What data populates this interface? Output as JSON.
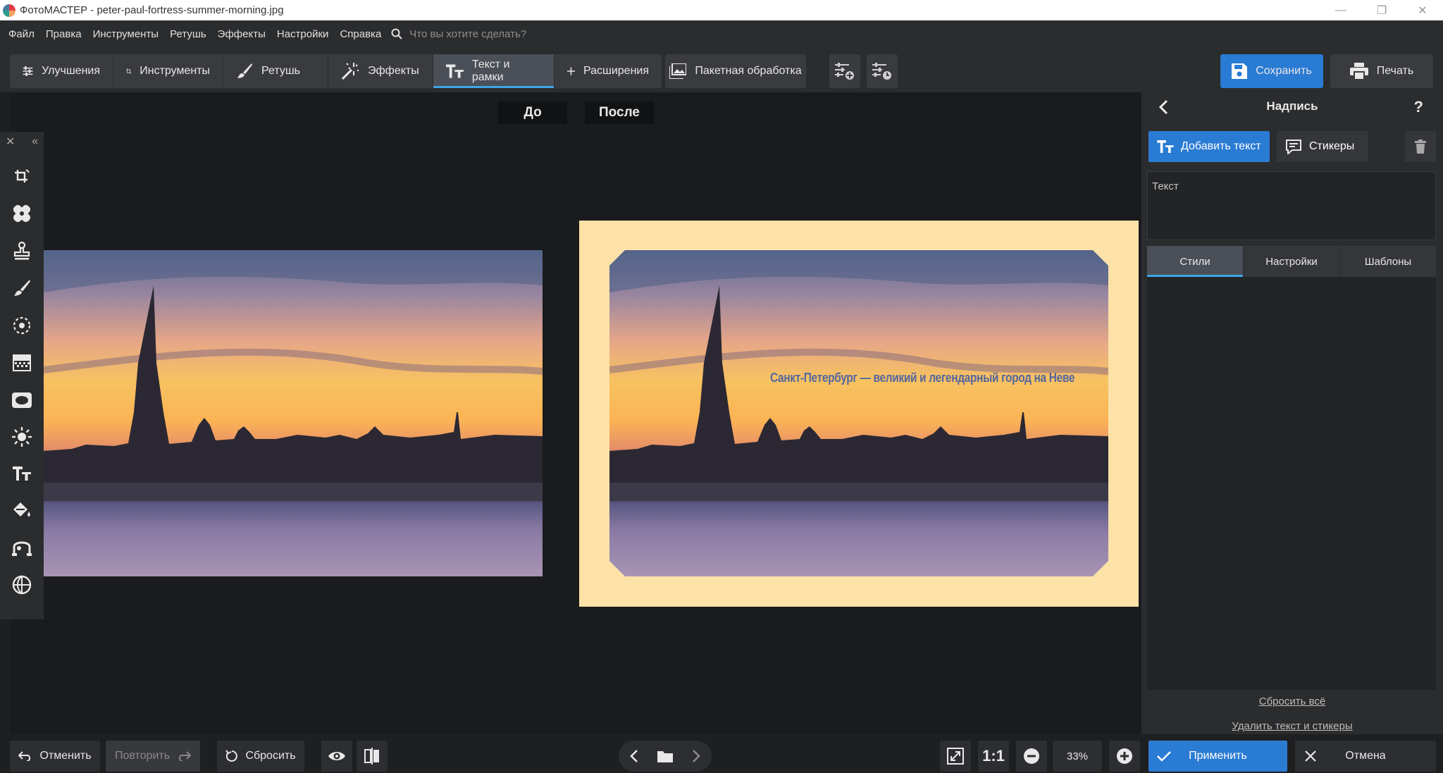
{
  "window": {
    "title": "ФотоМАСТЕР - peter-paul-fortress-summer-morning.jpg"
  },
  "menu": {
    "items": [
      "Файл",
      "Правка",
      "Инструменты",
      "Ретушь",
      "Эффекты",
      "Настройки",
      "Справка"
    ],
    "search_placeholder": "Что вы хотите сделать?"
  },
  "toolbar": {
    "tabs": [
      {
        "label": "Улучшения",
        "icon": "sliders-icon"
      },
      {
        "label": "Инструменты",
        "icon": "crop-icon"
      },
      {
        "label": "Ретушь",
        "icon": "brush-icon"
      },
      {
        "label": "Эффекты",
        "icon": "magic-wand-icon"
      },
      {
        "label": "Текст и рамки",
        "icon": "text-icon",
        "active": true
      },
      {
        "label": "Расширения",
        "icon": "plus-icon"
      }
    ],
    "batch_label": "Пакетная обработка",
    "save_label": "Сохранить",
    "print_label": "Печать"
  },
  "canvas": {
    "before_label": "До",
    "after_label": "После",
    "overlay_text": "Санкт-Петербург — великий и легендарный город на Неве",
    "frame_color": "#fde2a8",
    "overlay_text_color": "#5566a0"
  },
  "side_tools": [
    "crop-icon",
    "healing-patch-icon",
    "stamp-icon",
    "brush-icon",
    "radial-focus-icon",
    "gradient-icon",
    "vignette-icon",
    "light-icon",
    "text-icon",
    "paint-bucket-icon",
    "curve-icon",
    "globe-icon"
  ],
  "right_panel": {
    "title": "Надпись",
    "help": "?",
    "add_text_label": "Добавить текст",
    "stickers_label": "Стикеры",
    "text_value": "Текст",
    "tabs": [
      {
        "label": "Стили",
        "active": true
      },
      {
        "label": "Настройки"
      },
      {
        "label": "Шаблоны"
      }
    ],
    "reset_all_label": "Сбросить всё",
    "delete_label": "Удалить текст и стикеры"
  },
  "bottom": {
    "undo_label": "Отменить",
    "redo_label": "Повторить",
    "reset_label": "Сбросить",
    "zoom_ratio": "1:1",
    "zoom_level": "33%",
    "apply_label": "Применить",
    "cancel_label": "Отмена"
  },
  "colors": {
    "accent": "#2a7bd3",
    "active_tab_underline": "#3fa5e6",
    "background": "#1a1b1d",
    "panel": "#2b2c2e"
  }
}
